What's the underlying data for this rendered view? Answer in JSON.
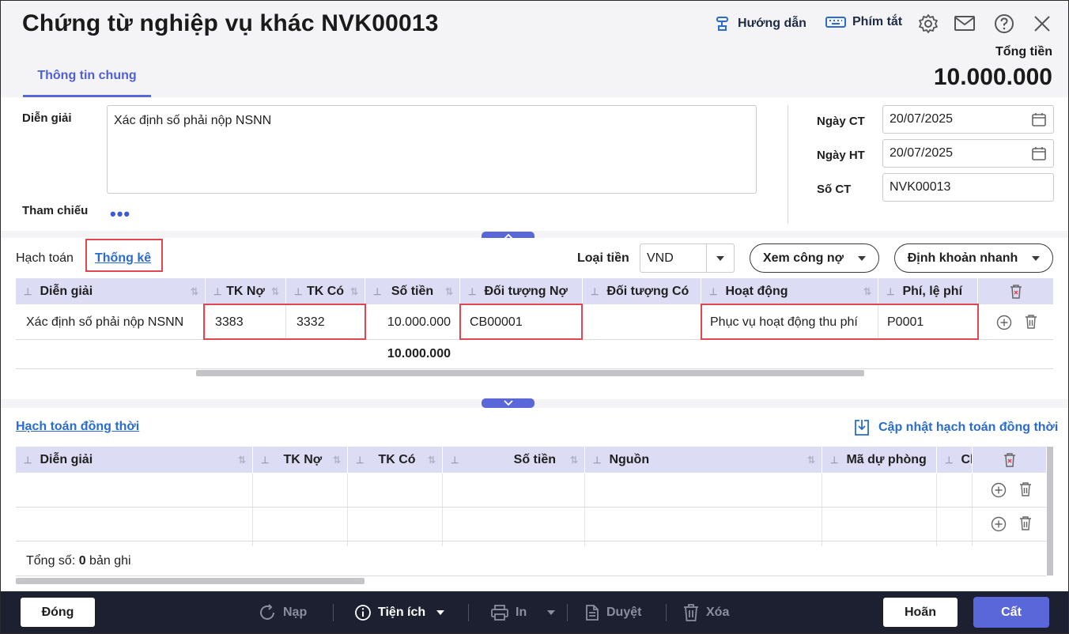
{
  "header": {
    "title": "Chứng từ nghiệp vụ khác NVK00013",
    "guide_label": "Hướng dẫn",
    "shortcut_label": "Phím tắt",
    "tab_general": "Thông tin chung",
    "total_label": "Tổng tiền",
    "total_value": "10.000.000"
  },
  "form": {
    "description_label": "Diễn giải",
    "description_value": "Xác định số phải nộp NSNN",
    "reference_label": "Tham chiếu",
    "reference_more": "•••",
    "date_ct_label": "Ngày CT",
    "date_ct_value": "20/07/2025",
    "date_ht_label": "Ngày HT",
    "date_ht_value": "20/07/2025",
    "so_ct_label": "Số CT",
    "so_ct_value": "NVK00013"
  },
  "entries": {
    "tab_accounting": "Hạch toán",
    "tab_statistics": "Thống kê",
    "currency_label": "Loại tiền",
    "currency_value": "VND",
    "debt_button": "Xem công nợ",
    "quick_button": "Định khoản nhanh",
    "columns": [
      "Diễn giải",
      "TK Nợ",
      "TK Có",
      "Số tiền",
      "Đối tượng Nợ",
      "Đối tượng Có",
      "Hoạt động",
      "Phí, lệ phí"
    ],
    "rows": [
      [
        "Xác định số phải nộp NSNN",
        "3383",
        "3332",
        "10.000.000",
        "CB00001",
        "",
        "Phục vụ hoạt động thu phí",
        "P0001"
      ]
    ],
    "sum_amount": "10.000.000"
  },
  "concurrent": {
    "link_label": "Hạch toán đồng thời",
    "update_label": "Cập nhật hạch toán đồng thời",
    "columns": [
      "Diễn giải",
      "TK Nợ",
      "TK Có",
      "Số tiền",
      "Nguồn",
      "Mã dự phòng",
      "Cl"
    ],
    "total_prefix": "Tổng số: ",
    "total_count": "0",
    "total_suffix": " bản ghi"
  },
  "footer": {
    "close": "Đóng",
    "reload": "Nạp",
    "utility": "Tiện ích",
    "print": "In",
    "approve": "Duyệt",
    "delete": "Xóa",
    "cancel": "Hoãn",
    "save": "Cất"
  },
  "colors": {
    "accent": "#5a67d8",
    "highlight": "#e0464f",
    "header_row": "#dcdcf5",
    "footer_bg": "#1d2030"
  }
}
